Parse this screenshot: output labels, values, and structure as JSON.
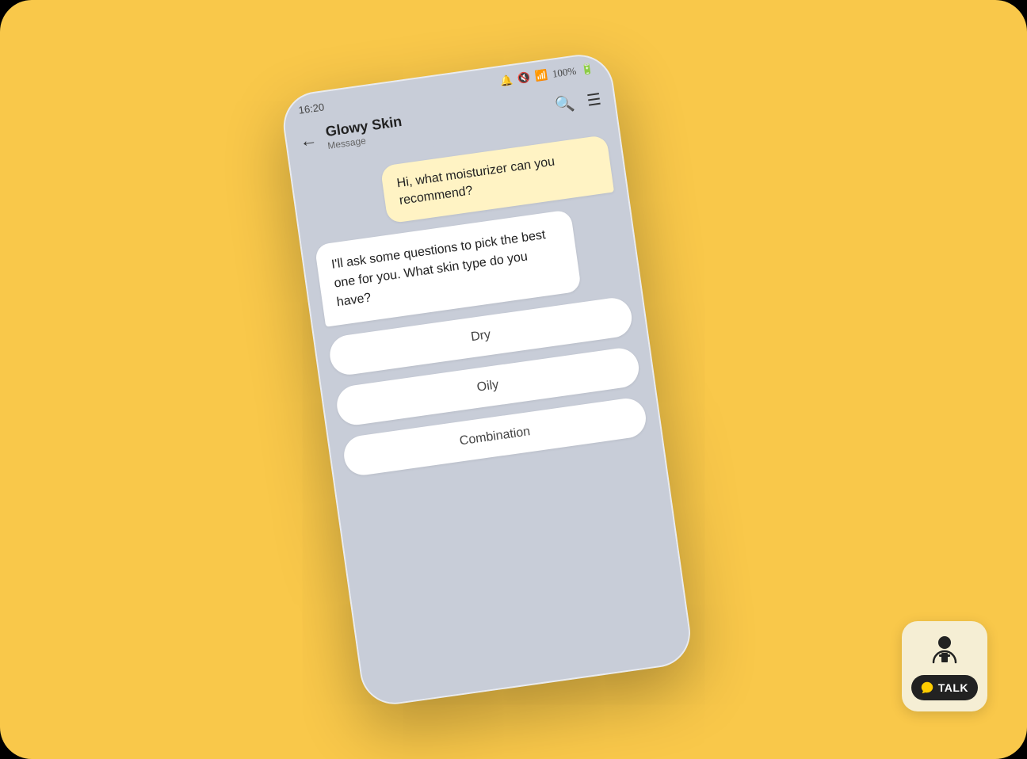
{
  "background": {
    "color": "#F9C84A"
  },
  "status_bar": {
    "time": "16:20",
    "battery": "100%",
    "icons": [
      "alarm",
      "mute",
      "wifi",
      "battery"
    ]
  },
  "header": {
    "title": "Glowy Skin",
    "subtitle": "Message",
    "back_label": "←"
  },
  "chat": {
    "user_message": "Hi, what moisturizer can you recommend?",
    "bot_message": "I'll ask some questions to pick the best one for you. What skin type do you have?",
    "options": [
      {
        "label": "Dry"
      },
      {
        "label": "Oily"
      },
      {
        "label": "Combination"
      }
    ]
  },
  "widget": {
    "talk_label": "TALK"
  }
}
